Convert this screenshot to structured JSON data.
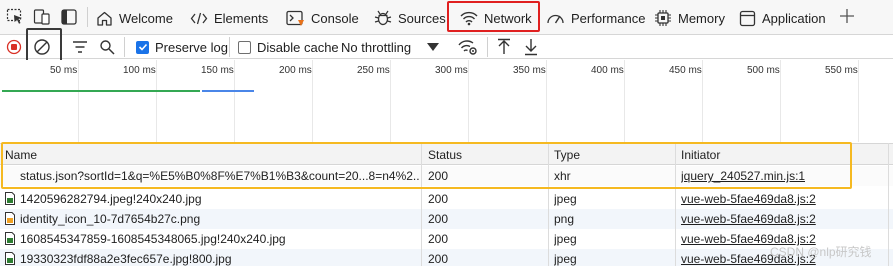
{
  "tabs": [
    {
      "label": "Welcome"
    },
    {
      "label": "Elements"
    },
    {
      "label": "Console"
    },
    {
      "label": "Sources"
    },
    {
      "label": "Network"
    },
    {
      "label": "Performance"
    },
    {
      "label": "Memory"
    },
    {
      "label": "Application"
    }
  ],
  "toolbar": {
    "preserve_log_label": "Preserve log",
    "preserve_log_checked": true,
    "disable_cache_label": "Disable cache",
    "disable_cache_checked": false,
    "throttling_value": "No throttling"
  },
  "timeline": {
    "ticks": [
      "50 ms",
      "100 ms",
      "150 ms",
      "200 ms",
      "250 ms",
      "300 ms",
      "350 ms",
      "400 ms",
      "450 ms",
      "500 ms",
      "550 ms"
    ]
  },
  "table": {
    "headers": {
      "name": "Name",
      "status": "Status",
      "type": "Type",
      "initiator": "Initiator"
    },
    "rows": [
      {
        "name": "status.json?sortId=1&q=%E5%B0%8F%E7%B1%B3&count=20...8=n4%2...",
        "status": "200",
        "type": "xhr",
        "initiator": "jquery_240527.min.js:1",
        "icon": "xhr-icon"
      },
      {
        "name": "1420596282794.jpeg!240x240.jpg",
        "status": "200",
        "type": "jpeg",
        "initiator": "vue-web-5fae469da8.js:2",
        "icon": "image-file-icon"
      },
      {
        "name": "identity_icon_10-7d7654b27c.png",
        "status": "200",
        "type": "png",
        "initiator": "vue-web-5fae469da8.js:2",
        "icon": "png-file-icon"
      },
      {
        "name": "1608545347859-1608545348065.jpg!240x240.jpg",
        "status": "200",
        "type": "jpeg",
        "initiator": "vue-web-5fae469da8.js:2",
        "icon": "image-file-icon"
      },
      {
        "name": "19330323fdf88a2e3fec657e.jpg!800.jpg",
        "status": "200",
        "type": "jpeg",
        "initiator": "vue-web-5fae469da8.js:2",
        "icon": "image-file-icon"
      }
    ]
  },
  "watermark": "CSDN @nlp研究钱",
  "colors": {
    "accent": "#1a73e8",
    "network_highlight": "#e02020",
    "row_highlight": "#f5b921"
  }
}
